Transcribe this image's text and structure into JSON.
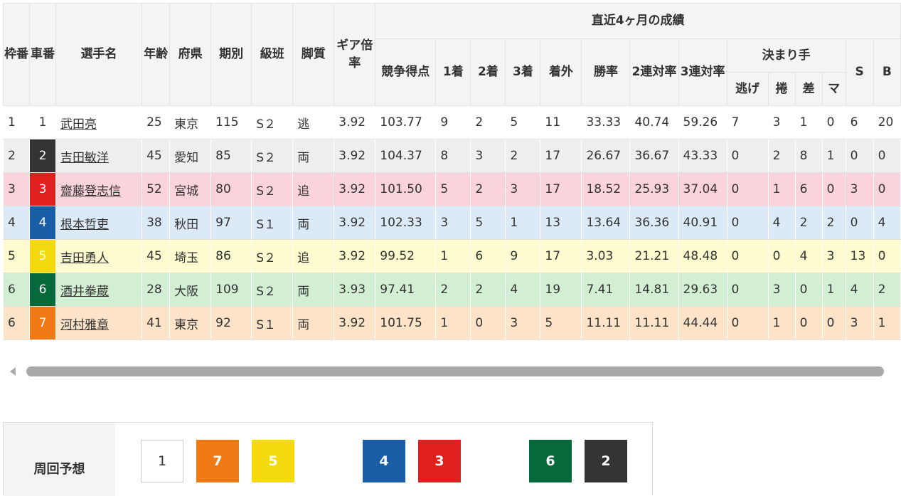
{
  "header": {
    "waku": "枠番",
    "car": "車番",
    "name": "選手名",
    "age": "年齢",
    "pref": "府県",
    "term": "期別",
    "class": "級班",
    "style": "脚質",
    "gear": "ギア倍率",
    "recent": "直近4ヶ月の成績",
    "score": "競争得点",
    "first": "1着",
    "second": "2着",
    "third": "3着",
    "out": "着外",
    "win": "勝率",
    "top2": "2連対率",
    "top3": "3連対率",
    "kimarite": "決まり手",
    "nige": "逃げ",
    "makuri": "捲",
    "sashi": "差",
    "mark": "マ",
    "s": "S",
    "b": "B"
  },
  "colors": {
    "car_1": "#ffffff",
    "car_2": "#333333",
    "car_3": "#e01f1f",
    "car_4": "#1a5ea8",
    "car_5": "#f5d90f",
    "car_6": "#06693b",
    "car_7": "#f07a16",
    "row_1": "#ffffff",
    "row_2": "#eeeeee",
    "row_3": "#fbd3dd",
    "row_4": "#dce9f6",
    "row_5": "#fdfbcf",
    "row_6": "#d2efd3",
    "row_7": "#fde3c7"
  },
  "riders": [
    {
      "waku": "1",
      "car": "1",
      "name": "武田亮",
      "age": "25",
      "pref": "東京",
      "term": "115",
      "class": "S２",
      "style": "逃",
      "gear": "3.92",
      "score": "103.77",
      "first": "9",
      "second": "2",
      "third": "5",
      "out": "11",
      "win": "33.33",
      "top2": "40.74",
      "top3": "59.26",
      "nige": "7",
      "makuri": "3",
      "sashi": "1",
      "mark": "0",
      "s": "6",
      "b": "20"
    },
    {
      "waku": "2",
      "car": "2",
      "name": "吉田敏洋",
      "age": "45",
      "pref": "愛知",
      "term": "85",
      "class": "S２",
      "style": "両",
      "gear": "3.92",
      "score": "104.37",
      "first": "8",
      "second": "3",
      "third": "2",
      "out": "17",
      "win": "26.67",
      "top2": "36.67",
      "top3": "43.33",
      "nige": "0",
      "makuri": "2",
      "sashi": "8",
      "mark": "1",
      "s": "0",
      "b": "0"
    },
    {
      "waku": "3",
      "car": "3",
      "name": "齋藤登志信",
      "age": "52",
      "pref": "宮城",
      "term": "80",
      "class": "S２",
      "style": "追",
      "gear": "3.92",
      "score": "101.50",
      "first": "5",
      "second": "2",
      "third": "3",
      "out": "17",
      "win": "18.52",
      "top2": "25.93",
      "top3": "37.04",
      "nige": "0",
      "makuri": "1",
      "sashi": "6",
      "mark": "0",
      "s": "3",
      "b": "0"
    },
    {
      "waku": "4",
      "car": "4",
      "name": "根本哲吏",
      "age": "38",
      "pref": "秋田",
      "term": "97",
      "class": "S１",
      "style": "両",
      "gear": "3.92",
      "score": "102.33",
      "first": "3",
      "second": "5",
      "third": "1",
      "out": "13",
      "win": "13.64",
      "top2": "36.36",
      "top3": "40.91",
      "nige": "0",
      "makuri": "4",
      "sashi": "2",
      "mark": "2",
      "s": "0",
      "b": "4"
    },
    {
      "waku": "5",
      "car": "5",
      "name": "吉田勇人",
      "age": "45",
      "pref": "埼玉",
      "term": "86",
      "class": "S２",
      "style": "追",
      "gear": "3.92",
      "score": "99.52",
      "first": "1",
      "second": "6",
      "third": "9",
      "out": "17",
      "win": "3.03",
      "top2": "21.21",
      "top3": "48.48",
      "nige": "0",
      "makuri": "0",
      "sashi": "4",
      "mark": "3",
      "s": "13",
      "b": "0"
    },
    {
      "waku": "6",
      "car": "6",
      "name": "酒井拳蔵",
      "age": "28",
      "pref": "大阪",
      "term": "109",
      "class": "S２",
      "style": "両",
      "gear": "3.93",
      "score": "97.41",
      "first": "2",
      "second": "2",
      "third": "4",
      "out": "19",
      "win": "7.41",
      "top2": "14.81",
      "top3": "29.63",
      "nige": "0",
      "makuri": "3",
      "sashi": "0",
      "mark": "1",
      "s": "4",
      "b": "2"
    },
    {
      "waku": "6",
      "car": "7",
      "name": "河村雅章",
      "age": "41",
      "pref": "東京",
      "term": "92",
      "class": "S１",
      "style": "両",
      "gear": "3.92",
      "score": "101.75",
      "first": "1",
      "second": "0",
      "third": "3",
      "out": "5",
      "win": "11.11",
      "top2": "11.11",
      "top3": "44.44",
      "nige": "0",
      "makuri": "1",
      "sashi": "0",
      "mark": "0",
      "s": "3",
      "b": "1"
    }
  ],
  "prediction": {
    "label": "周回予想",
    "chips": [
      "1",
      "7",
      "5",
      "4",
      "3",
      "6",
      "2"
    ]
  }
}
